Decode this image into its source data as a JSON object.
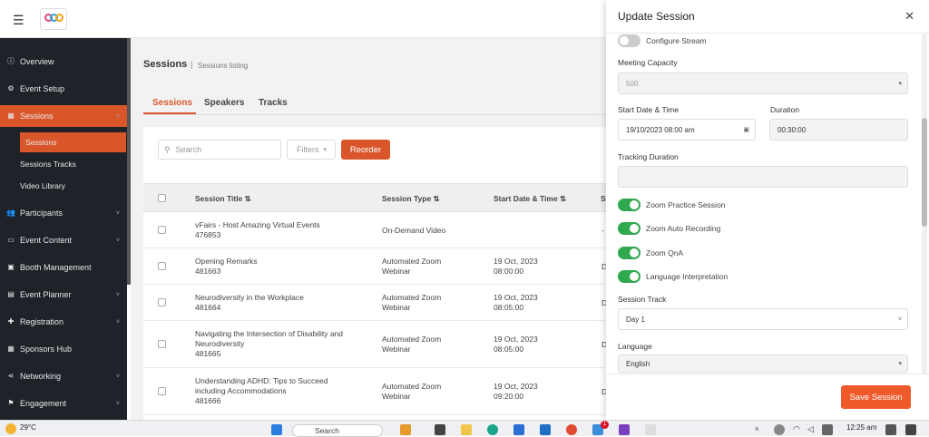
{
  "sidebar": {
    "items": [
      {
        "label": "Overview",
        "icon": "info-icon"
      },
      {
        "label": "Event Setup",
        "icon": "gear-icon"
      },
      {
        "label": "Sessions",
        "icon": "grid-icon"
      },
      {
        "label": "Participants",
        "icon": "users-icon"
      },
      {
        "label": "Event Content",
        "icon": "content-icon"
      },
      {
        "label": "Booth Management",
        "icon": "booth-icon"
      },
      {
        "label": "Event Planner",
        "icon": "planner-icon"
      },
      {
        "label": "Registration",
        "icon": "registration-icon"
      },
      {
        "label": "Sponsors Hub",
        "icon": "sponsors-icon"
      },
      {
        "label": "Networking",
        "icon": "share-icon"
      },
      {
        "label": "Engagement",
        "icon": "flag-icon"
      }
    ],
    "subitems": [
      "Sessions",
      "Sessions Tracks",
      "Video Library"
    ]
  },
  "page": {
    "title": "Sessions",
    "subtitle": "Sessions listing",
    "sep": "|"
  },
  "tabs": [
    "Sessions",
    "Speakers",
    "Tracks"
  ],
  "toolbar": {
    "search_placeholder": "Search",
    "filters_label": "Filters",
    "reorder_label": "Reorder"
  },
  "table": {
    "headers": [
      "Session Title ⇅",
      "Session Type ⇅",
      "Start Date & Time ⇅",
      "S"
    ],
    "rows": [
      {
        "title": "vFairs - Host Amazing Virtual Events",
        "id": "476853",
        "type": "On-Demand Video",
        "type2": "",
        "date": "",
        "time": "",
        "trail": "-"
      },
      {
        "title": "Opening Remarks",
        "id": "481663",
        "type": "Automated Zoom",
        "type2": "Webinar",
        "date": "19 Oct, 2023",
        "time": "08:00:00",
        "trail": "D"
      },
      {
        "title": "Neurodiversity in the Workplace",
        "id": "481664",
        "type": "Automated Zoom",
        "type2": "Webinar",
        "date": "19 Oct, 2023",
        "time": "08:05:00",
        "trail": "D"
      },
      {
        "title": "Navigating the Intersection of Disability and",
        "title2": "Neurodiversity",
        "id": "481665",
        "type": "Automated Zoom",
        "type2": "Webinar",
        "date": "19 Oct, 2023",
        "time": "08:05:00",
        "trail": "D"
      },
      {
        "title": "Understanding ADHD: Tips to Succeed",
        "title2": "including Accommodations",
        "id": "481666",
        "type": "Automated Zoom",
        "type2": "Webinar",
        "date": "19 Oct, 2023",
        "time": "09:20:00",
        "trail": "D"
      }
    ]
  },
  "panel": {
    "title": "Update Session",
    "configure_stream": "Configure Stream",
    "meeting_capacity_label": "Meeting Capacity",
    "meeting_capacity_value": "500",
    "start_label": "Start Date & Time",
    "start_value": "19/10/2023 08:00 am",
    "duration_label": "Duration",
    "duration_value": "00:30:00",
    "tracking_label": "Tracking Duration",
    "tracking_value": "",
    "toggles": [
      {
        "label": "Zoom Practice Session",
        "on": true
      },
      {
        "label": "Zoom Auto Recording",
        "on": true
      },
      {
        "label": "Zoom QnA",
        "on": true
      },
      {
        "label": "Language Interpretation",
        "on": true
      }
    ],
    "track_label": "Session Track",
    "track_value": "Day 1",
    "language_label": "Language",
    "language_value": "English",
    "save_label": "Save Session"
  },
  "taskbar": {
    "weather": "29°C",
    "search": "Search",
    "time": "12:25 am",
    "badge": "1"
  },
  "colors": {
    "accent": "#d9562b",
    "save": "#f05a2b",
    "toggle_on": "#2fa84f",
    "sidebar_bg": "#1f2228"
  }
}
